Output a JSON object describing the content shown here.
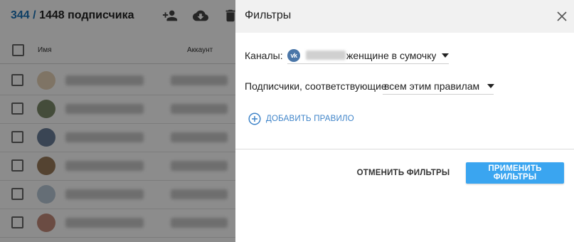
{
  "list": {
    "selected_count": "344",
    "separator": "/",
    "total_label": "1448 подписчика",
    "columns": {
      "name": "Имя",
      "account": "Аккаунт"
    },
    "rows": [
      {
        "avatar_color": "#e8d3b8"
      },
      {
        "avatar_color": "#7d8a6a"
      },
      {
        "avatar_color": "#6b7f9a"
      },
      {
        "avatar_color": "#9a7b5a"
      },
      {
        "avatar_color": "#b8c8d8"
      },
      {
        "avatar_color": "#c48a7a"
      }
    ],
    "toolbar_icons": [
      "add-users-icon",
      "cloud-download-icon",
      "trash-icon"
    ]
  },
  "filter_panel": {
    "title": "Фильтры",
    "channels_label": "Каналы:",
    "channel_value": "женщине в сумочку Г",
    "channel_icon": "vk-icon",
    "subscribers_label": "Подписчики, соответствующие",
    "match_value": "всем этим правилам",
    "add_rule_label": "ДОБАВИТЬ ПРАВИЛО",
    "cancel_label": "ОТМЕНИТЬ ФИЛЬТРЫ",
    "apply_label": "ПРИМЕНИТЬ ФИЛЬТРЫ"
  },
  "colors": {
    "accent": "#3aa5f0",
    "link": "#3f84c9",
    "selected_count": "#1a73b8",
    "vk": "#4a76a8",
    "header_bg": "#f1f1f1"
  }
}
